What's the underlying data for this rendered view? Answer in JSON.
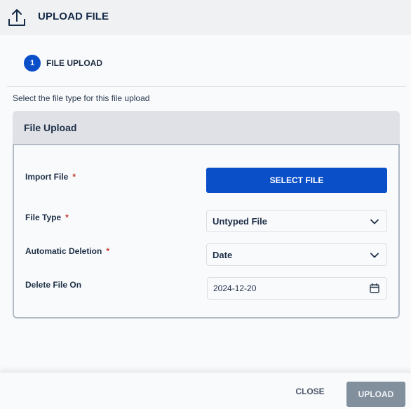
{
  "header": {
    "icon": "upload-icon",
    "title": "UPLOAD FILE"
  },
  "stepper": {
    "steps": [
      {
        "number": "1",
        "label": "FILE UPLOAD",
        "active": true
      }
    ]
  },
  "instructions": "Select the file type for this file upload",
  "card": {
    "title": "File Upload",
    "fields": {
      "import_file": {
        "label": "Import File",
        "required": "*",
        "button_label": "SELECT FILE"
      },
      "file_type": {
        "label": "File Type",
        "required": "*",
        "value": "Untyped File",
        "icon": "chevron-down-icon"
      },
      "automatic_deletion": {
        "label": "Automatic Deletion",
        "required": "*",
        "value": "Date",
        "icon": "chevron-down-icon"
      },
      "delete_file_on": {
        "label": "Delete File On",
        "value": "2024-12-20",
        "icon": "calendar-icon"
      }
    }
  },
  "footer": {
    "close_label": "CLOSE",
    "upload_label": "UPLOAD"
  },
  "colors": {
    "primary": "#0b4fc8",
    "required": "#c0392b",
    "disabled_button": "#828f9d"
  }
}
